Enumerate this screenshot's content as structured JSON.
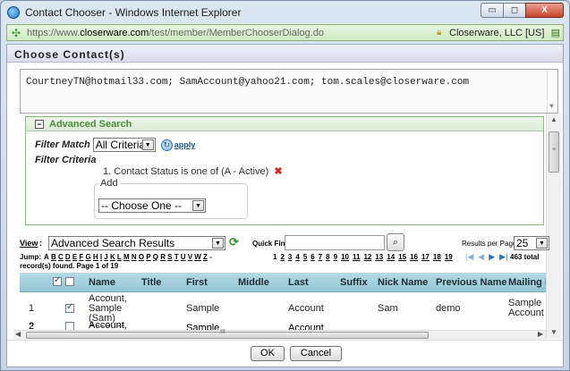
{
  "window": {
    "title": "Contact Chooser - Windows Internet Explorer",
    "url_prefix": "https://www.",
    "url_domain": "closerware.com",
    "url_path": "/test/member/MemberChooserDialog.do",
    "certificate": "Closerware, LLC [US]",
    "minimize_glyph": "▭",
    "restore_glyph": "◻",
    "close_glyph": "X"
  },
  "dialog": {
    "title": "Choose Contact(s)",
    "recipients": "CourtneyTN@hotmail33.com; SamAccount@yahoo21.com;  tom.scales@closerware.com"
  },
  "advanced_search": {
    "header": "Advanced Search",
    "toggle_glyph": "−",
    "filter_match_label": "Filter Match",
    "filter_match_value": "All Criteria",
    "apply_label": "apply",
    "filter_criteria_label": "Filter Criteria",
    "criteria": "1.  Contact Status is one of (A - Active)",
    "add_label": "Add",
    "add_select_value": "-- Choose One --"
  },
  "toolbar": {
    "view_label": "View",
    "view_value": "Advanced Search Results",
    "quick_find_label": "Quick Find:",
    "results_per_page_label": "Results per Page",
    "results_per_page_value": "25"
  },
  "pager": {
    "jump_label": "Jump:",
    "letters": [
      "A",
      "B",
      "C",
      "D",
      "E",
      "F",
      "G",
      "H",
      "I",
      "J",
      "K",
      "L",
      "M",
      "N",
      "O",
      "P",
      "Q",
      "R",
      "S",
      "T",
      "U",
      "V",
      "W",
      "Z",
      "-"
    ],
    "pages": [
      "1",
      "2",
      "3",
      "4",
      "5",
      "6",
      "7",
      "8",
      "9",
      "10",
      "11",
      "12",
      "13",
      "14",
      "15",
      "16",
      "17",
      "18",
      "19"
    ],
    "total": "463 total",
    "found": "record(s) found. Page 1 of 19"
  },
  "grid": {
    "columns": [
      "Name",
      "Title",
      "First",
      "Middle",
      "Last",
      "Suffix",
      "Nick Name",
      "Previous Name",
      "Mailing Nam"
    ],
    "rows": [
      {
        "num": "1",
        "name_l1": "Account,",
        "name_l2": "Sample",
        "name_l3": "(Sam)",
        "title": "",
        "first": "Sample",
        "middle": "",
        "last": "Account",
        "suffix": "",
        "nick": "Sam",
        "previous": "demo",
        "mailing_l1": "Sample",
        "mailing_l2": "Account"
      },
      {
        "num": "2",
        "name_l1": "Account,",
        "first": "Sample",
        "last": "Account"
      }
    ]
  },
  "footer": {
    "ok_label": "OK",
    "cancel_label": "Cancel"
  }
}
